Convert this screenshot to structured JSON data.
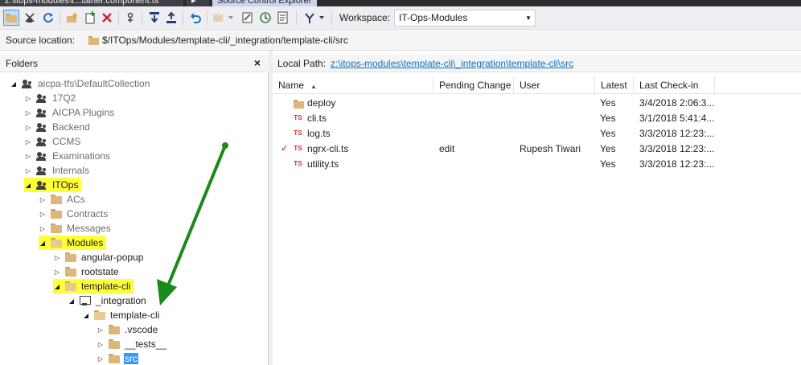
{
  "tabs": [
    {
      "label": "z:\\itops-modules\\t...tainer.component.ts"
    },
    {
      "label": "▸"
    },
    {
      "label": "Source Control Explorer"
    }
  ],
  "toolbar": {
    "workspace_label": "Workspace:",
    "workspace_value": "IT-Ops-Modules"
  },
  "source_location": {
    "label": "Source location:",
    "path": "$/ITOps/Modules/template-cli/_integration/template-cli/src"
  },
  "folders_pane": {
    "title": "Folders",
    "close": "×",
    "tree": [
      {
        "label": "aicpa-tfs\\DefaultCollection",
        "icon": "team",
        "expander": "◢",
        "level": 0,
        "style": "dim"
      },
      {
        "label": "17Q2",
        "icon": "team",
        "expander": "▷",
        "level": 1,
        "style": "dim"
      },
      {
        "label": "AICPA Plugins",
        "icon": "team",
        "expander": "▷",
        "level": 1,
        "style": "dim"
      },
      {
        "label": "Backend",
        "icon": "team",
        "expander": "▷",
        "level": 1,
        "style": "dim"
      },
      {
        "label": "CCMS",
        "icon": "team",
        "expander": "▷",
        "level": 1,
        "style": "dim"
      },
      {
        "label": "Examinations",
        "icon": "team",
        "expander": "▷",
        "level": 1,
        "style": "dim"
      },
      {
        "label": "Internals",
        "icon": "team",
        "expander": "▷",
        "level": 1,
        "style": "dim"
      },
      {
        "label": "ITOps",
        "icon": "team",
        "expander": "◢",
        "level": 1,
        "style": "hl"
      },
      {
        "label": "ACs",
        "icon": "folder",
        "expander": "▷",
        "level": 2,
        "style": "dim"
      },
      {
        "label": "Contracts",
        "icon": "folder",
        "expander": "▷",
        "level": 2,
        "style": "dim"
      },
      {
        "label": "Messages",
        "icon": "folder",
        "expander": "▷",
        "level": 2,
        "style": "dim"
      },
      {
        "label": "Modules",
        "icon": "folder-open",
        "expander": "◢",
        "level": 2,
        "style": "hl"
      },
      {
        "label": "angular-popup",
        "icon": "folder",
        "expander": "▷",
        "level": 3,
        "style": ""
      },
      {
        "label": "rootstate",
        "icon": "folder",
        "expander": "▷",
        "level": 3,
        "style": ""
      },
      {
        "label": "template-cli",
        "icon": "folder-open",
        "expander": "◢",
        "level": 3,
        "style": "hl"
      },
      {
        "label": "_integration",
        "icon": "mapped",
        "expander": "◢",
        "level": 4,
        "style": ""
      },
      {
        "label": "template-cli",
        "icon": "folder-open",
        "expander": "◢",
        "level": 5,
        "style": ""
      },
      {
        "label": ".vscode",
        "icon": "folder",
        "expander": "▷",
        "level": 6,
        "style": ""
      },
      {
        "label": "__tests__",
        "icon": "folder",
        "expander": "▷",
        "level": 6,
        "style": ""
      },
      {
        "label": "src",
        "icon": "folder",
        "expander": "▷",
        "level": 6,
        "style": "sel"
      }
    ]
  },
  "right_pane": {
    "local_path_label": "Local Path:",
    "local_path": "z:\\itops-modules\\template-cli\\_integration\\template-cli\\src",
    "columns": [
      "Name",
      "Pending Change",
      "User",
      "Latest",
      "Last Check-in"
    ],
    "sort_indicator": "▲",
    "files": [
      {
        "type": "folder",
        "name": "deploy",
        "pending": "",
        "user": "",
        "latest": "Yes",
        "checkin": "3/4/2018 2:06:3...",
        "mark": ""
      },
      {
        "type": "ts",
        "name": "cli.ts",
        "pending": "",
        "user": "",
        "latest": "Yes",
        "checkin": "3/1/2018 5:41:4...",
        "mark": ""
      },
      {
        "type": "ts",
        "name": "log.ts",
        "pending": "",
        "user": "",
        "latest": "Yes",
        "checkin": "3/3/2018 12:23:...",
        "mark": ""
      },
      {
        "type": "ts",
        "name": "ngrx-cli.ts",
        "pending": "edit",
        "user": "Rupesh Tiwari",
        "latest": "Yes",
        "checkin": "3/3/2018 12:23:...",
        "mark": "✓"
      },
      {
        "type": "ts",
        "name": "utility.ts",
        "pending": "",
        "user": "",
        "latest": "Yes",
        "checkin": "3/3/2018 12:23:...",
        "mark": ""
      }
    ],
    "ts_badge": "TS"
  },
  "colors": {
    "highlight": "#ffff3a",
    "selection": "#3399ff",
    "annotation_arrow": "#1a8a1a"
  }
}
